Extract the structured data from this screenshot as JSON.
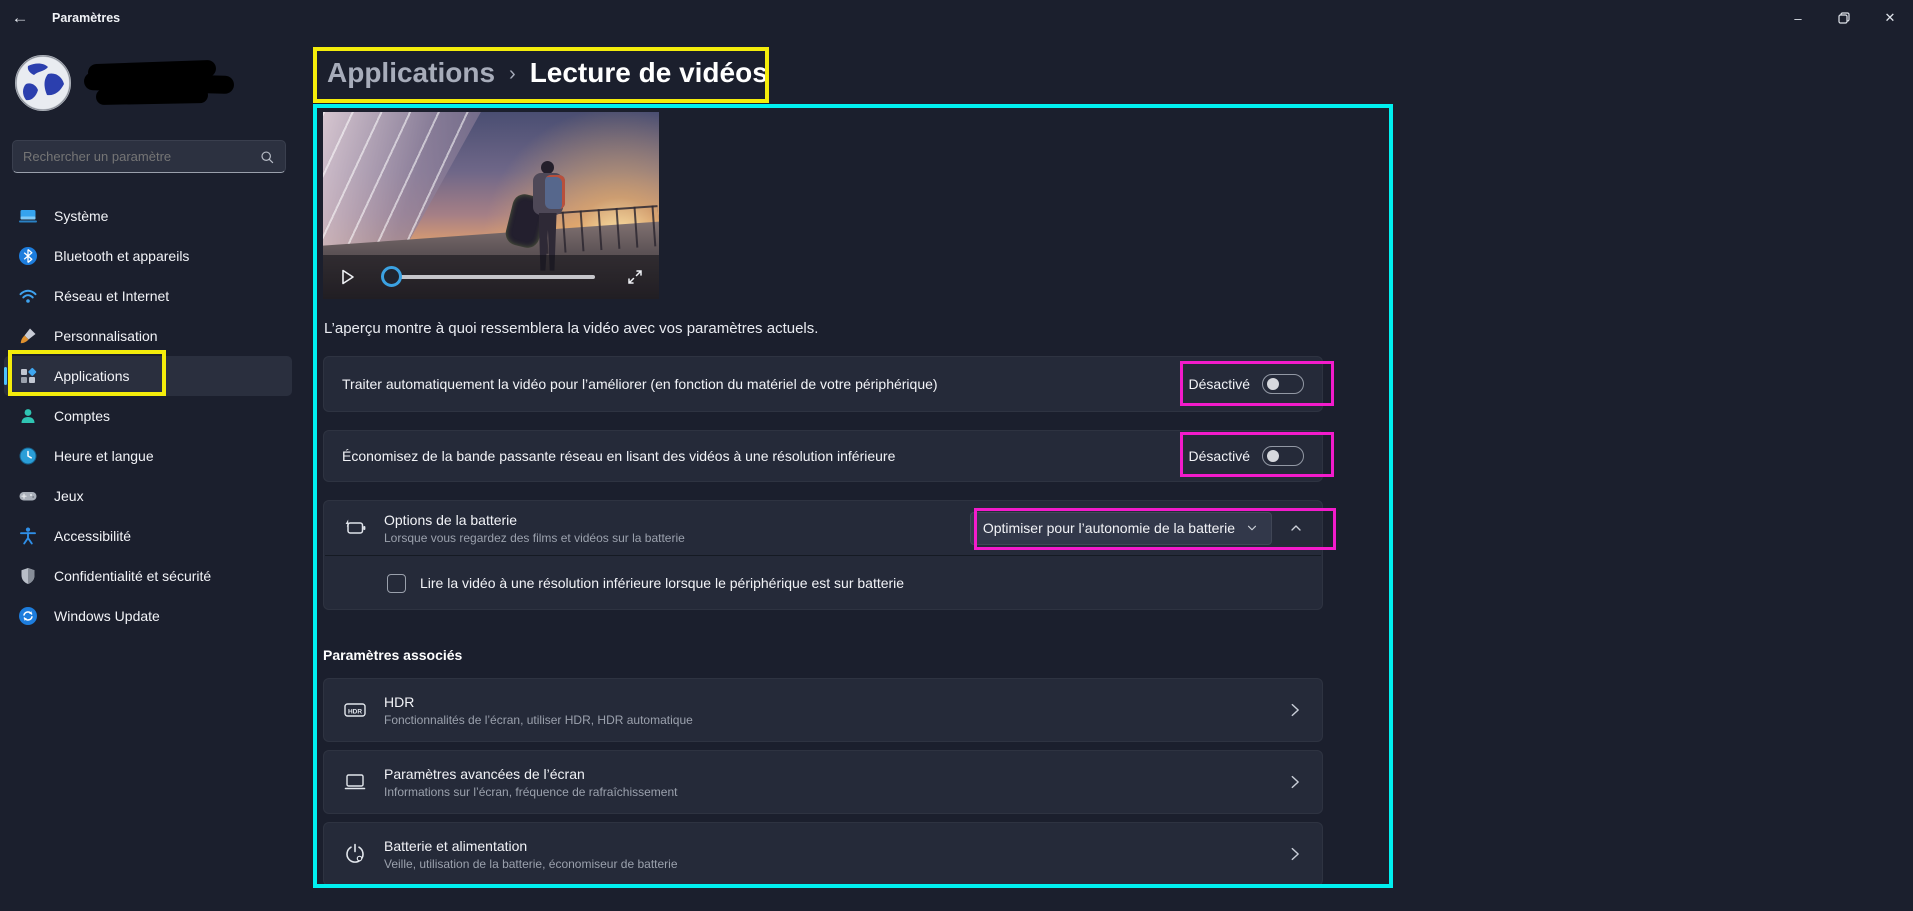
{
  "titlebar": {
    "title": "Paramètres"
  },
  "sidebar": {
    "search_placeholder": "Rechercher un paramètre",
    "items": [
      {
        "label": "Système"
      },
      {
        "label": "Bluetooth et appareils"
      },
      {
        "label": "Réseau et Internet"
      },
      {
        "label": "Personnalisation"
      },
      {
        "label": "Applications",
        "selected": true
      },
      {
        "label": "Comptes"
      },
      {
        "label": "Heure et langue"
      },
      {
        "label": "Jeux"
      },
      {
        "label": "Accessibilité"
      },
      {
        "label": "Confidentialité et sécurité"
      },
      {
        "label": "Windows Update"
      }
    ]
  },
  "breadcrumb": {
    "parent": "Applications",
    "separator": "›",
    "current": "Lecture de vidéos"
  },
  "preview_caption": "L’aperçu montre à quoi ressemblera la vidéo avec vos paramètres actuels.",
  "settings": {
    "process_video": {
      "label": "Traiter automatiquement la vidéo pour l’améliorer (en fonction du matériel de votre périphérique)",
      "toggle_state": "Désactivé"
    },
    "save_bandwidth": {
      "label": "Économisez de la bande passante réseau en lisant des vidéos à une résolution inférieure",
      "toggle_state": "Désactivé"
    },
    "battery_options": {
      "title": "Options de la batterie",
      "subtitle": "Lorsque vous regardez des films et vidéos sur la batterie",
      "dropdown_value": "Optimiser pour l’autonomie de la batterie"
    },
    "low_res_checkbox": {
      "label": "Lire la vidéo à une résolution inférieure lorsque le périphérique est sur batterie",
      "checked": false
    }
  },
  "related": {
    "heading": "Paramètres associés",
    "items": [
      {
        "title": "HDR",
        "subtitle": "Fonctionnalités de l’écran, utiliser HDR, HDR automatique"
      },
      {
        "title": "Paramètres avancées de l’écran",
        "subtitle": "Informations sur l’écran, fréquence de rafraîchissement"
      },
      {
        "title": "Batterie et alimentation",
        "subtitle": "Veille, utilisation de la batterie, économiseur de batterie"
      }
    ]
  },
  "annotations": {
    "yellow": "#f4ec0b",
    "magenta": "#f31bcb",
    "cyan": "#00f0f0"
  },
  "theme": {
    "accent": "#4cc2ff",
    "background": "#1b1f2d",
    "card": "#252a39"
  }
}
